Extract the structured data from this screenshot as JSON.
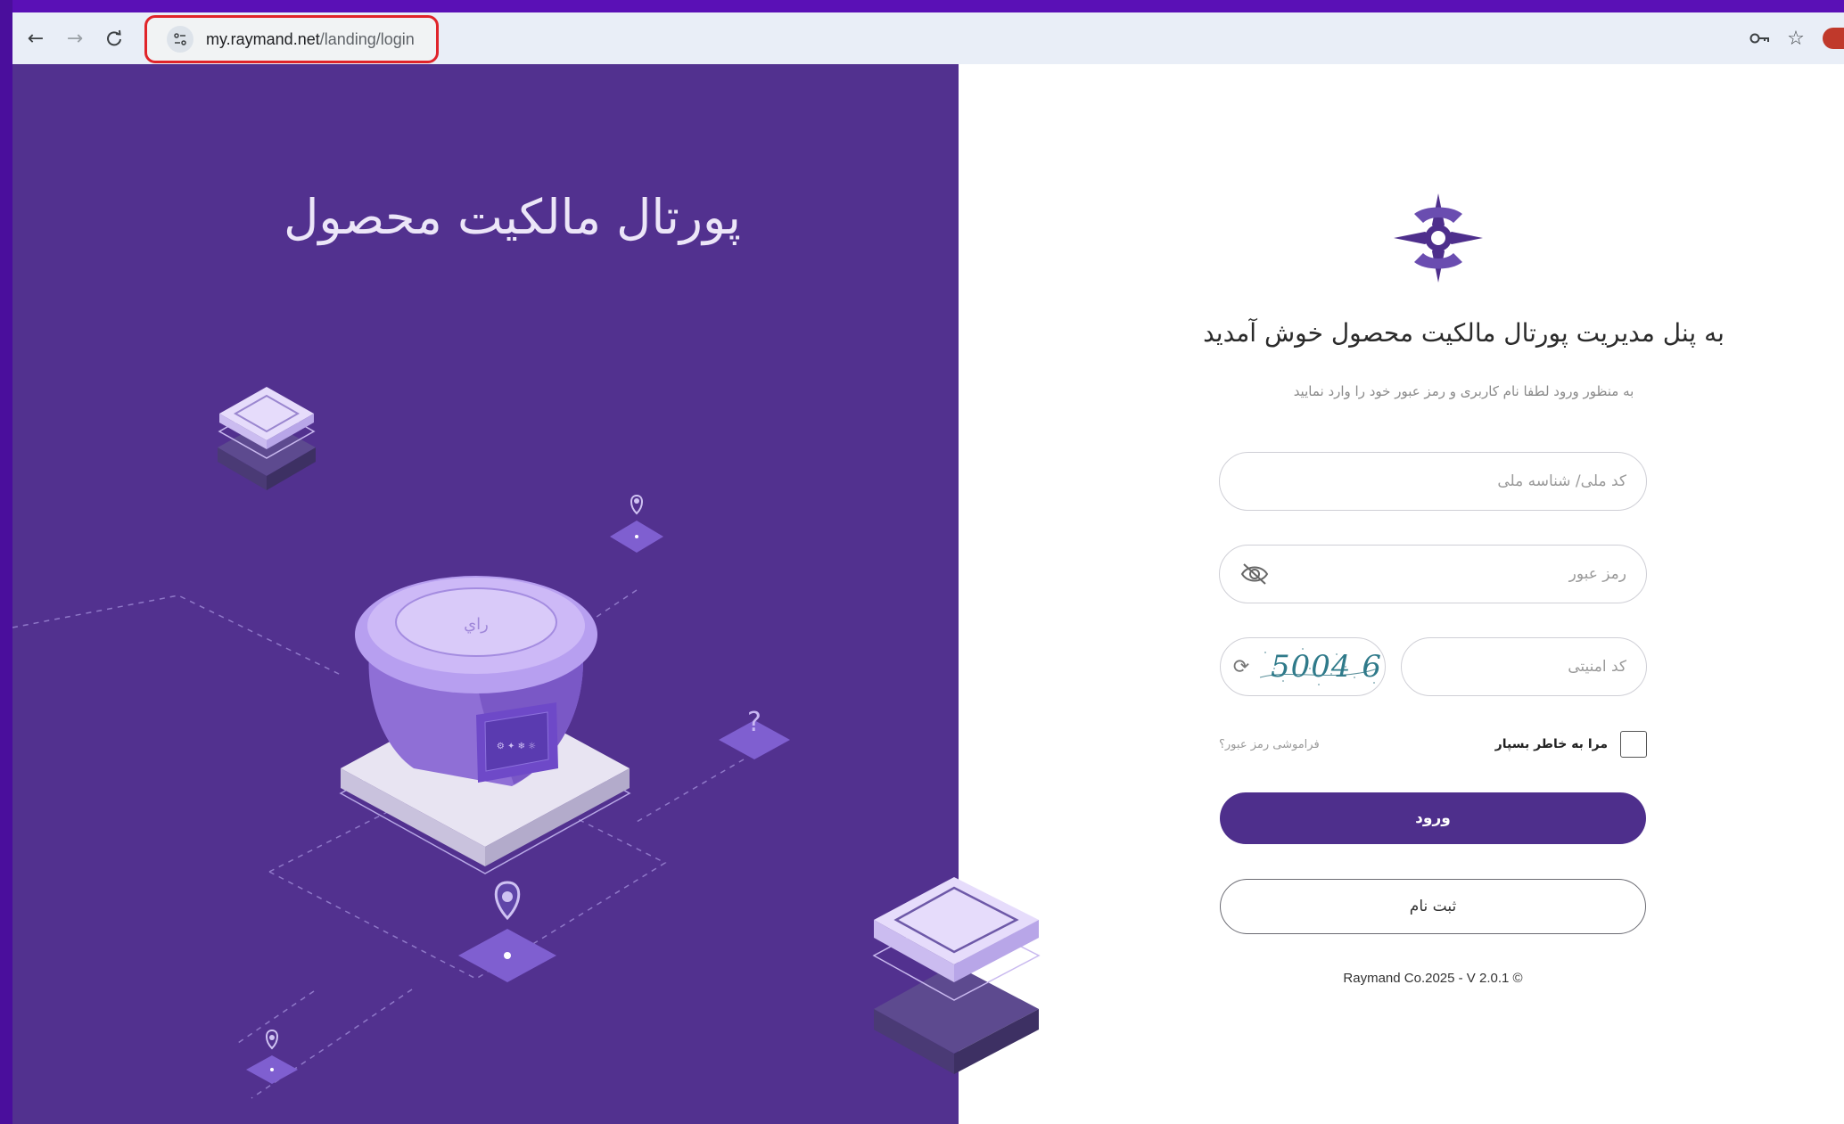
{
  "browser": {
    "url_host": "my.raymand.net",
    "url_path": "/landing/login",
    "back_icon": "arrow-left-icon",
    "forward_icon": "arrow-right-icon",
    "reload_icon": "reload-icon",
    "site_info_icon": "tune-icon",
    "password_key_icon": "key-icon",
    "bookmark_icon": "star-icon"
  },
  "left": {
    "title": "پورتال مالکیت محصول",
    "question_mark": "?"
  },
  "login": {
    "heading": "به پنل مدیریت پورتال مالکیت محصول خوش آمدید",
    "subheading": "به منظور ورود لطفا نام کاربری و رمز عبور خود را وارد نمایید",
    "national_id_placeholder": "کد ملی/ شناسه ملی",
    "password_placeholder": "رمز عبور",
    "captcha_placeholder": "کد امنیتی",
    "captcha_text": "5004 6",
    "remember_me": "مرا به خاطر بسپار",
    "forgot_password": "فراموشی رمز عبور؟",
    "login_button": "ورود",
    "register_button": "ثبت نام",
    "copyright": "Raymand Co.2025 - V 2.0.1 ©"
  },
  "colors": {
    "brand_purple": "#4e2f8c",
    "panel_purple": "#52318f",
    "frame_purple": "#5a10b6",
    "highlight_red": "#e0242a"
  }
}
